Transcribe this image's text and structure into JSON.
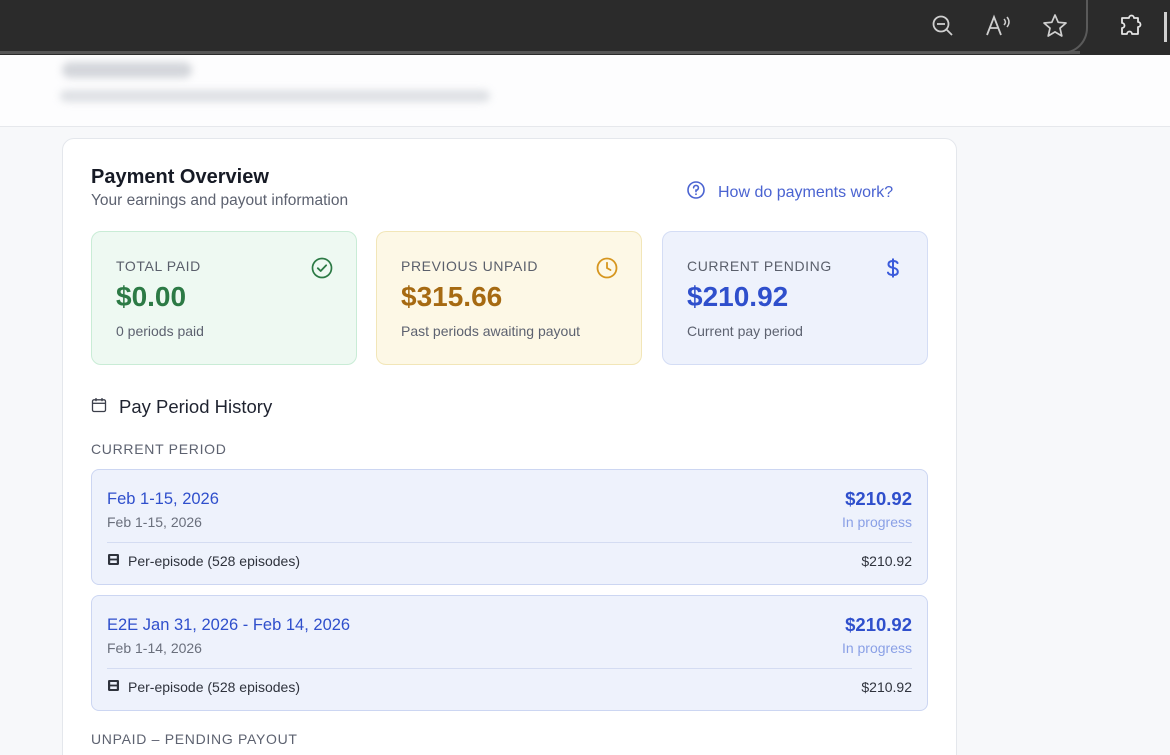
{
  "browser": {
    "icons": [
      "zoom-out-icon",
      "read-aloud-icon",
      "favorite-star-icon",
      "extensions-icon"
    ]
  },
  "overview": {
    "title": "Payment Overview",
    "subtitle": "Your earnings and payout information",
    "help_link": "How do payments work?"
  },
  "stats": [
    {
      "label": "TOTAL PAID",
      "value": "$0.00",
      "note": "0 periods paid",
      "icon": "check-circle-icon",
      "color": "#2c7a45"
    },
    {
      "label": "PREVIOUS UNPAID",
      "value": "$315.66",
      "note": "Past periods awaiting payout",
      "icon": "clock-icon",
      "color": "#a66a12"
    },
    {
      "label": "CURRENT PENDING",
      "value": "$210.92",
      "note": "Current pay period",
      "icon": "dollar-icon",
      "color": "#2f4fcc"
    }
  ],
  "history": {
    "title": "Pay Period History",
    "current_label": "CURRENT PERIOD",
    "unpaid_label": "UNPAID – PENDING PAYOUT",
    "periods": [
      {
        "name": "Feb 1-15, 2026",
        "dates": "Feb 1-15, 2026",
        "amount": "$210.92",
        "status": "In progress",
        "line_label": "Per-episode (528 episodes)",
        "line_amount": "$210.92"
      },
      {
        "name": "E2E Jan 31, 2026 - Feb 14, 2026",
        "dates": "Feb 1-14, 2026",
        "amount": "$210.92",
        "status": "In progress",
        "line_label": "Per-episode (528 episodes)",
        "line_amount": "$210.92"
      }
    ]
  }
}
